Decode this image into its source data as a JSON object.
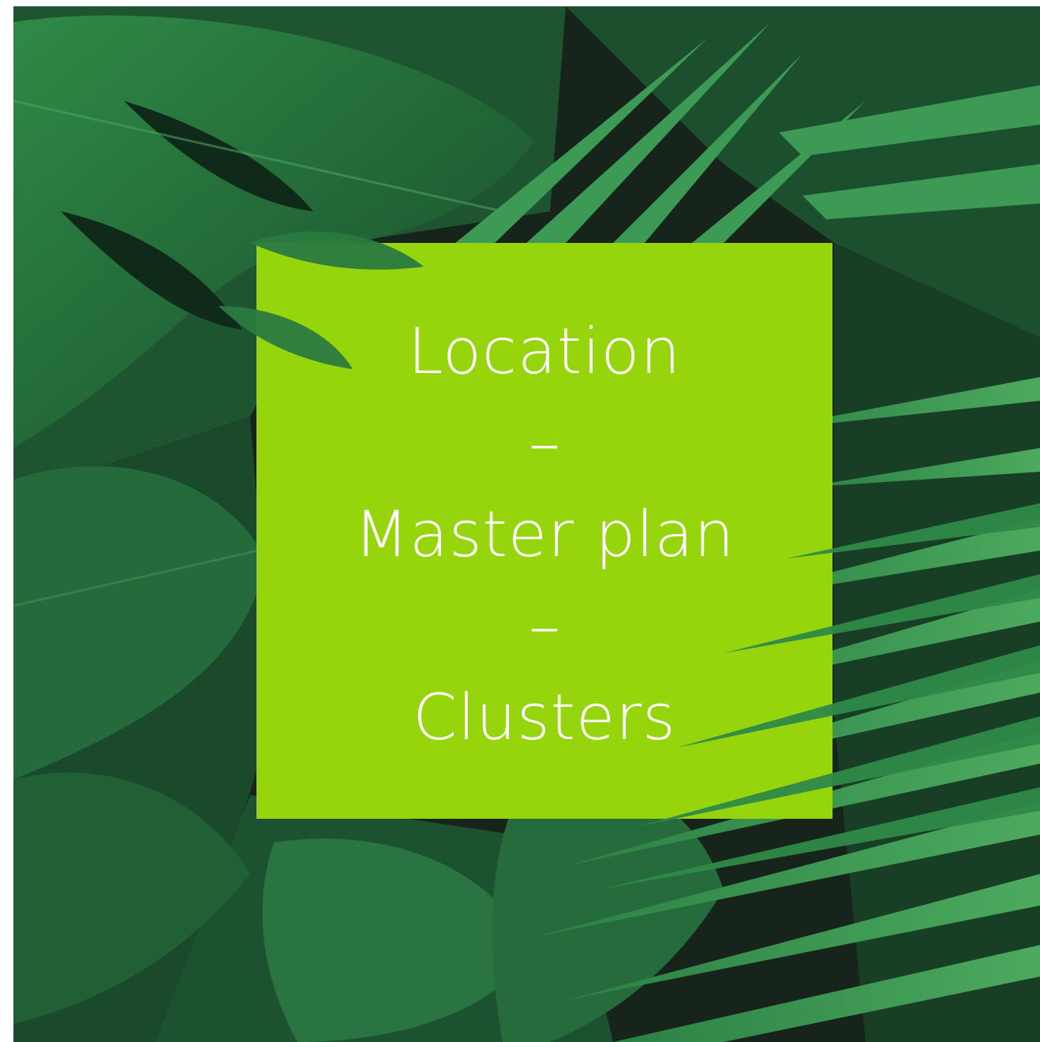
{
  "image": {
    "background_color": "#1a2a20",
    "leaf_dark": "#1f5a32",
    "leaf_mid": "#2d7a43",
    "leaf_light": "#3f9a55",
    "card_color": "#96d40c",
    "text_color": "#ffffff"
  },
  "card": {
    "line1": "Location",
    "sep1": "–",
    "line2": "Master plan",
    "sep2": "–",
    "line3": "Clusters"
  }
}
